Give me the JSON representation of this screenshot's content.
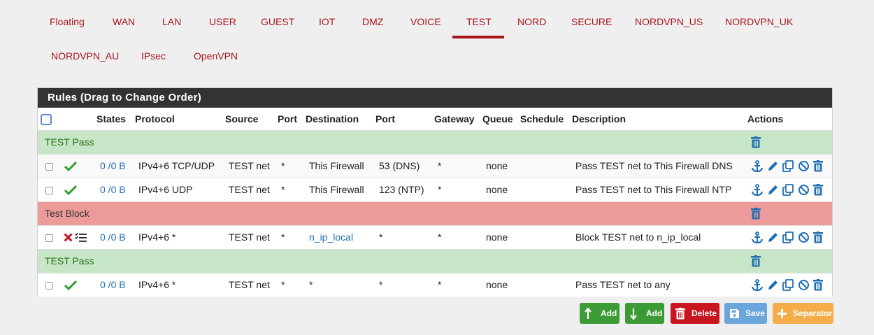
{
  "tabs": [
    "Floating",
    "WAN",
    "LAN",
    "USER",
    "GUEST",
    "IOT",
    "DMZ",
    "VOICE",
    "TEST",
    "NORD",
    "SECURE",
    "NORDVPN_US",
    "NORDVPN_UK",
    "NORDVPN_AU",
    "IPsec",
    "OpenVPN"
  ],
  "active_tab": "TEST",
  "panel_title": "Rules (Drag to Change Order)",
  "columns": {
    "states": "States",
    "protocol": "Protocol",
    "source": "Source",
    "port": "Port",
    "destination": "Destination",
    "dport": "Port",
    "gateway": "Gateway",
    "queue": "Queue",
    "schedule": "Schedule",
    "description": "Description",
    "actions": "Actions"
  },
  "separators": [
    {
      "label": "TEST Pass",
      "color": "green"
    },
    {
      "label": "Test Block",
      "color": "red"
    },
    {
      "label": "TEST Pass",
      "color": "green"
    }
  ],
  "rules": [
    {
      "action": "pass",
      "states": "0 /0 B",
      "protocol": "IPv4+6 TCP/UDP",
      "source": "TEST net",
      "port": "*",
      "destination": "This Firewall",
      "dport": "53 (DNS)",
      "gateway": "*",
      "queue": "none",
      "description": "Pass TEST net to This Firewall DNS"
    },
    {
      "action": "pass",
      "states": "0 /0 B",
      "protocol": "IPv4+6 UDP",
      "source": "TEST net",
      "port": "*",
      "destination": "This Firewall",
      "dport": "123 (NTP)",
      "gateway": "*",
      "queue": "none",
      "description": "Pass TEST net to This Firewall NTP"
    },
    {
      "action": "block",
      "states": "0 /0 B",
      "protocol": "IPv4+6 *",
      "source": "TEST net",
      "port": "*",
      "destination": "n_ip_local",
      "dport": "*",
      "gateway": "*",
      "queue": "none",
      "description": "Block TEST net to n_ip_local"
    },
    {
      "action": "pass",
      "states": "0 /0 B",
      "protocol": "IPv4+6 *",
      "source": "TEST net",
      "port": "*",
      "destination": "*",
      "dport": "*",
      "gateway": "*",
      "queue": "none",
      "description": "Pass TEST net to any"
    }
  ],
  "buttons": {
    "add_top": "Add",
    "add_bottom": "Add",
    "delete": "Delete",
    "save": "Save",
    "separator": "Separator"
  },
  "colors": {
    "accent": "#a8161c",
    "link": "#1f6eb3",
    "pass_green": "#2e9e2e",
    "block_red": "#c9151e",
    "btn_green": "#3d9b35",
    "btn_red": "#c9151e",
    "btn_blue": "#6aa6dc",
    "btn_orange": "#f5ad4c"
  }
}
